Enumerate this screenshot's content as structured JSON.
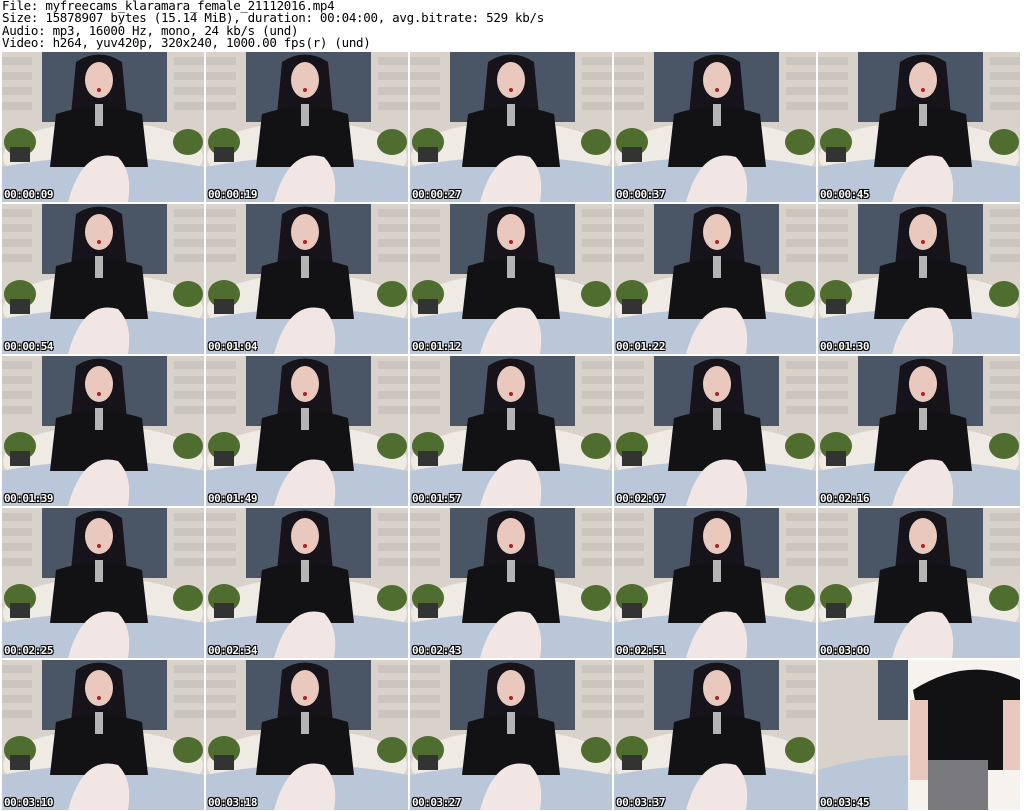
{
  "header": {
    "file": "File: myfreecams_klaramara_female_21112016.mp4",
    "size": "Size: 15878907 bytes (15.14 MiB), duration: 00:04:00, avg.bitrate: 529 kb/s",
    "audio": "Audio: mp3, 16000 Hz, mono, 24 kb/s (und)",
    "video": "Video: h264, yuv420p, 320x240, 1000.00 fps(r) (und)"
  },
  "thumbnails": [
    {
      "timestamp": "00:00:09"
    },
    {
      "timestamp": "00:00:19"
    },
    {
      "timestamp": "00:00:27"
    },
    {
      "timestamp": "00:00:37"
    },
    {
      "timestamp": "00:00:45"
    },
    {
      "timestamp": "00:00:54"
    },
    {
      "timestamp": "00:01:04"
    },
    {
      "timestamp": "00:01:12"
    },
    {
      "timestamp": "00:01:22"
    },
    {
      "timestamp": "00:01:30"
    },
    {
      "timestamp": "00:01:39"
    },
    {
      "timestamp": "00:01:49"
    },
    {
      "timestamp": "00:01:57"
    },
    {
      "timestamp": "00:02:07"
    },
    {
      "timestamp": "00:02:16"
    },
    {
      "timestamp": "00:02:25"
    },
    {
      "timestamp": "00:02:34"
    },
    {
      "timestamp": "00:02:43"
    },
    {
      "timestamp": "00:02:51"
    },
    {
      "timestamp": "00:03:00"
    },
    {
      "timestamp": "00:03:10"
    },
    {
      "timestamp": "00:03:18"
    },
    {
      "timestamp": "00:03:27"
    },
    {
      "timestamp": "00:03:37"
    },
    {
      "timestamp": "00:03:45"
    }
  ],
  "colors": {
    "wall": "#d8d2cb",
    "brick": "#c4bdb5",
    "poster": "#4a5566",
    "hair": "#16141a",
    "shirt": "#121214",
    "skin": "#e9c9bd",
    "stockings": "#f1e6e4",
    "bed": "#b9c7d8",
    "plant": "#4f6d2e",
    "headboard": "#efebe4"
  }
}
